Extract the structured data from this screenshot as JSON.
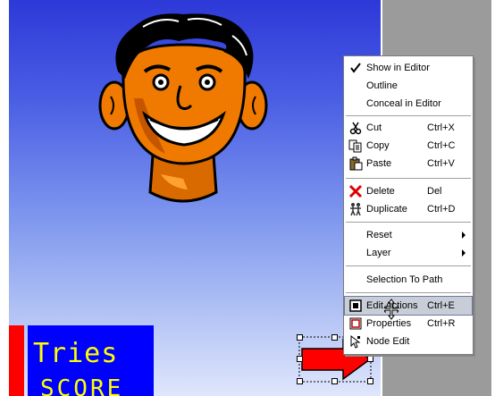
{
  "scene": {
    "tries_label": "Tries",
    "score_label": "SCORE"
  },
  "context_menu": {
    "items": [
      {
        "label": "Show in Editor",
        "checked": true
      },
      {
        "label": "Outline"
      },
      {
        "label": "Conceal in Editor"
      },
      {
        "label": "Cut",
        "shortcut": "Ctrl+X",
        "icon": "scissors-icon"
      },
      {
        "label": "Copy",
        "shortcut": "Ctrl+C",
        "icon": "copy-icon"
      },
      {
        "label": "Paste",
        "shortcut": "Ctrl+V",
        "icon": "paste-icon"
      },
      {
        "label": "Delete",
        "shortcut": "Del",
        "icon": "delete-x-icon"
      },
      {
        "label": "Duplicate",
        "shortcut": "Ctrl+D",
        "icon": "duplicate-icon"
      },
      {
        "label": "Reset",
        "submenu": true
      },
      {
        "label": "Layer",
        "submenu": true
      },
      {
        "label": "Selection To Path"
      },
      {
        "label": "Edit Actions",
        "shortcut": "Ctrl+E",
        "icon": "edit-actions-icon",
        "highlighted": true
      },
      {
        "label": "Properties",
        "shortcut": "Ctrl+R",
        "icon": "properties-icon"
      },
      {
        "label": "Node Edit",
        "icon": "node-edit-icon"
      }
    ]
  },
  "colors": {
    "canvas_top": "#2d39d8",
    "canvas_bottom": "#dfe6fc",
    "pasteboard": "#9b9b9b",
    "text_box": "#0000ff",
    "text_color": "#ffff00",
    "arrow": "#ff0000"
  }
}
